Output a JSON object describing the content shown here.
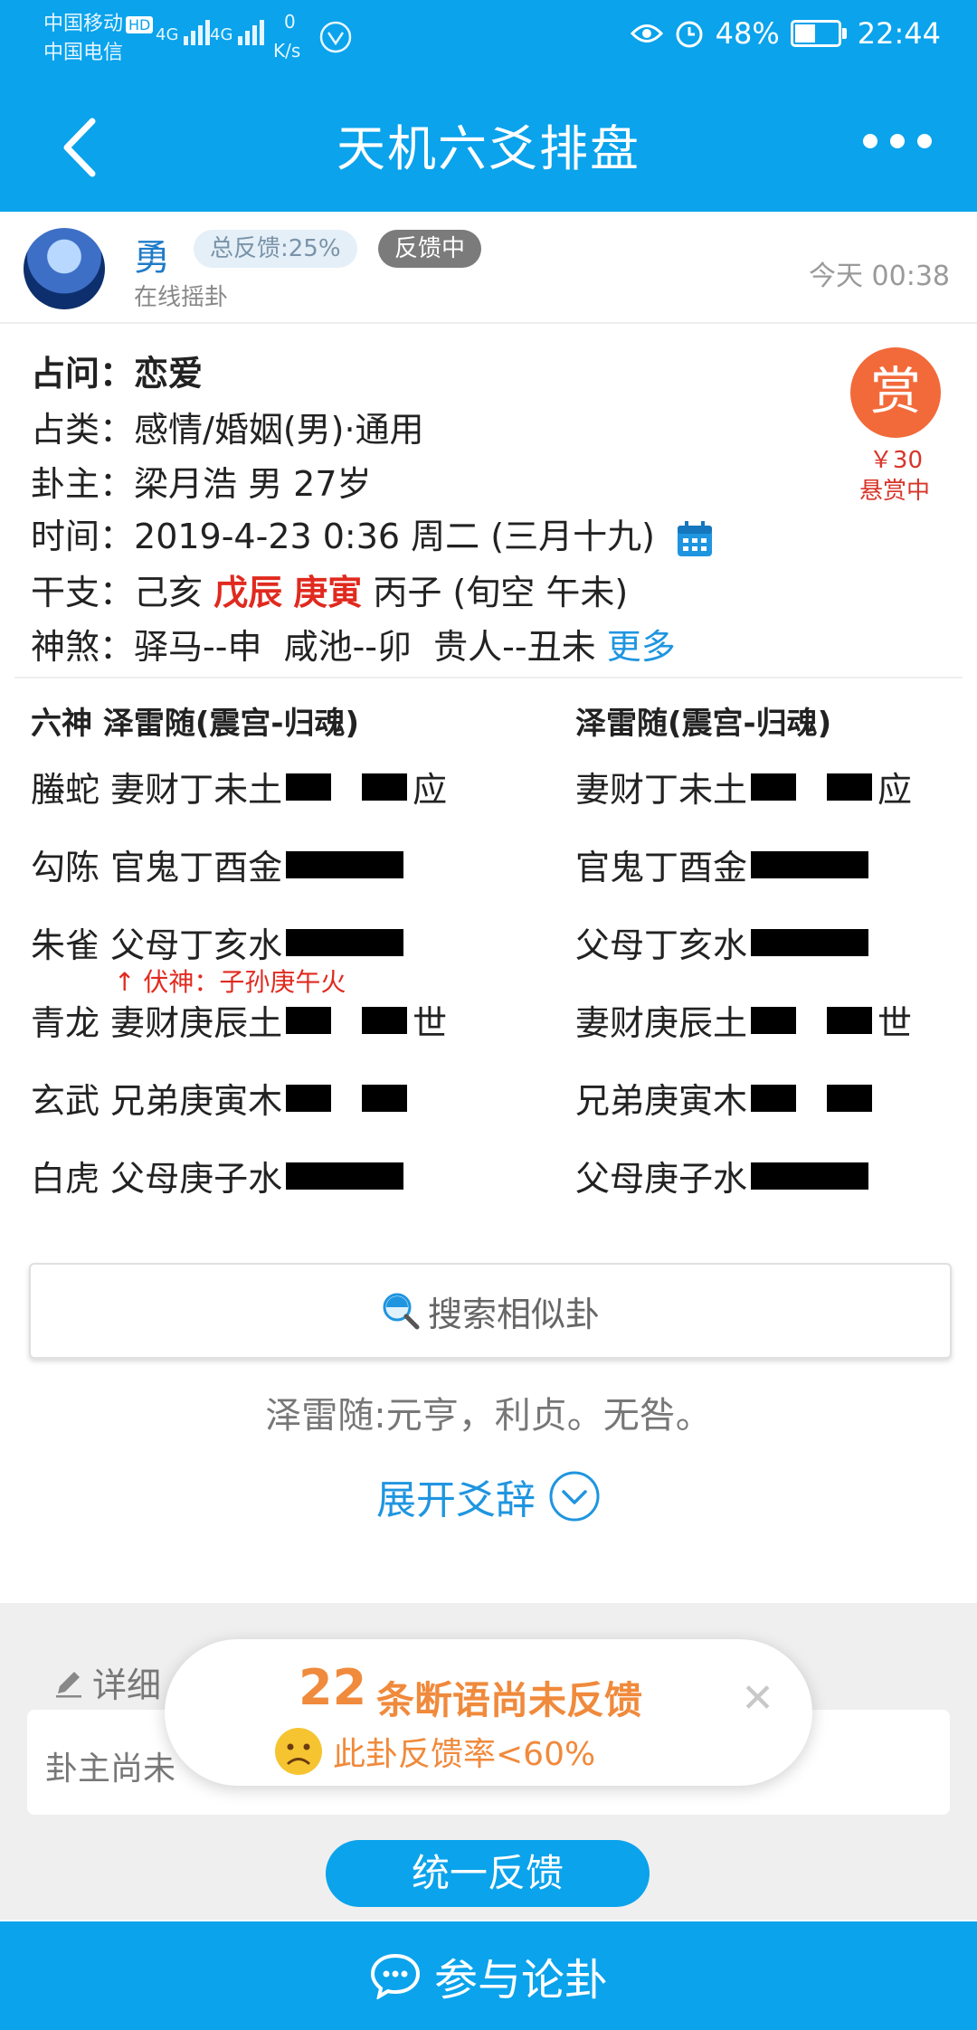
{
  "status": {
    "carrier1": "中国移动",
    "carrier1_badge": "HD",
    "carrier2": "中国电信",
    "net1": "4G",
    "net2": "4G",
    "speed_value": "0",
    "speed_unit": "K/s",
    "battery": "48%",
    "battery_level_percent": 48,
    "time": "22:44"
  },
  "header": {
    "title": "天机六爻排盘"
  },
  "user": {
    "name": "勇",
    "feedback_rate": "总反馈:25%",
    "status_badge": "反馈中",
    "method": "在线摇卦",
    "post_time": "今天 00:38"
  },
  "info": {
    "question_label": "占问：",
    "question": "恋爱",
    "category_label": "占类：",
    "category": "感情/婚姻(男)·通用",
    "owner_label": "卦主：",
    "owner": "梁月浩 男 27岁",
    "time_label": "时间：",
    "time": "2019-4-23 0:36 周二 (三月十九)",
    "ganzhi_label": "干支：",
    "ganzhi_1": "己亥",
    "ganzhi_2": "戊辰",
    "ganzhi_3": "庚寅",
    "ganzhi_4": "丙子 (旬空 午未)",
    "shensha_label": "神煞：",
    "shensha": "驿马--申  咸池--卯  贵人--丑未",
    "shensha_more": "更多"
  },
  "reward": {
    "icon_text": "赏",
    "amount": "￥30",
    "status": "悬赏中"
  },
  "hexagram": {
    "left_header": "六神 泽雷随(震宫-归魂)",
    "right_header": "泽雷随(震宫-归魂)",
    "left_lines": [
      {
        "text": "螣蛇 妻财丁未土",
        "yin": true,
        "mark": "应"
      },
      {
        "text": "勾陈 官鬼丁酉金",
        "yin": false,
        "mark": ""
      },
      {
        "text": "朱雀 父母丁亥水",
        "yin": false,
        "mark": ""
      },
      {
        "text": "青龙 妻财庚辰土",
        "yin": true,
        "mark": "世"
      },
      {
        "text": "玄武 兄弟庚寅木",
        "yin": true,
        "mark": ""
      },
      {
        "text": "白虎 父母庚子水",
        "yin": false,
        "mark": ""
      }
    ],
    "right_lines": [
      {
        "text": "妻财丁未土",
        "yin": true,
        "mark": "应"
      },
      {
        "text": "官鬼丁酉金",
        "yin": false,
        "mark": ""
      },
      {
        "text": "父母丁亥水",
        "yin": false,
        "mark": ""
      },
      {
        "text": "妻财庚辰土",
        "yin": true,
        "mark": "世"
      },
      {
        "text": "兄弟庚寅木",
        "yin": true,
        "mark": ""
      },
      {
        "text": "父母庚子水",
        "yin": false,
        "mark": ""
      }
    ],
    "fushen": "↑ 伏神：子孙庚午火"
  },
  "search": {
    "label": "搜索相似卦"
  },
  "gua_text": "泽雷随:元亨，利贞。无咎。",
  "expand_label": "展开爻辞",
  "detail": {
    "label": "详细",
    "text": "卦主尚未"
  },
  "popup": {
    "count": "22",
    "title": "条断语尚未反馈",
    "subtitle": "此卦反馈率<60%"
  },
  "unify_button": "统一反馈",
  "bottom_bar": "参与论卦"
}
